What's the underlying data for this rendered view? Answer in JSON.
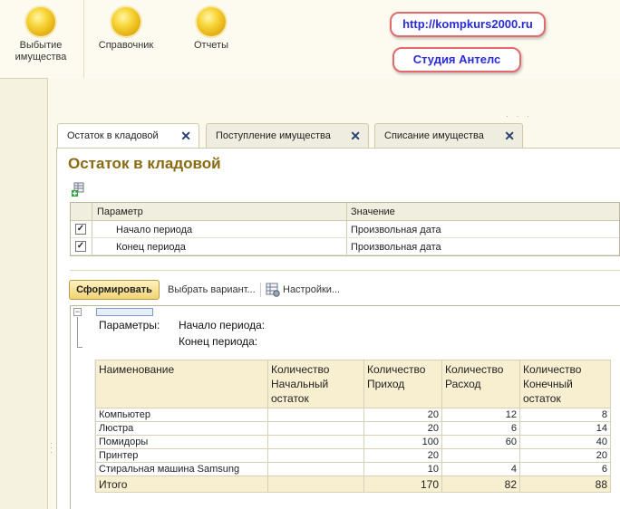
{
  "top_sections": [
    {
      "label": "Выбытие имущества",
      "icon": "orb-icon"
    },
    {
      "label": "Справочник",
      "icon": "orb-icon"
    },
    {
      "label": "Отчеты",
      "icon": "orb-icon"
    }
  ],
  "badges": {
    "site": "http://kompkurs2000.ru",
    "studio": "Студия Антелс"
  },
  "tabs": [
    {
      "label": "Остаток в кладовой",
      "active": true
    },
    {
      "label": "Поступление имущества",
      "active": false
    },
    {
      "label": "Списание имущества",
      "active": false
    }
  ],
  "page_title": "Остаток в кладовой",
  "settings": {
    "headers": {
      "param": "Параметр",
      "value": "Значение"
    },
    "rows": [
      {
        "checked": true,
        "param": "Начало периода",
        "value": "Произвольная дата"
      },
      {
        "checked": true,
        "param": "Конец периода",
        "value": "Произвольная дата"
      }
    ]
  },
  "toolbar": {
    "generate": "Сформировать",
    "choose_variant": "Выбрать вариант...",
    "settings": "Настройки..."
  },
  "report": {
    "params_label": "Параметры:",
    "start_label": "Начало периода:",
    "end_label": "Конец периода:",
    "headers": {
      "name": "Наименование",
      "begin": [
        "Количество",
        "Начальный",
        "остаток"
      ],
      "income": [
        "Количество",
        "Приход"
      ],
      "expense": [
        "Количество",
        "Расход"
      ],
      "end": [
        "Количество",
        "Конечный",
        "остаток"
      ]
    },
    "rows": [
      {
        "name": "Компьютер",
        "begin": "",
        "income": "20",
        "expense": "12",
        "end": "8"
      },
      {
        "name": "Люстра",
        "begin": "",
        "income": "20",
        "expense": "6",
        "end": "14"
      },
      {
        "name": "Помидоры",
        "begin": "",
        "income": "100",
        "expense": "60",
        "end": "40"
      },
      {
        "name": "Принтер",
        "begin": "",
        "income": "20",
        "expense": "",
        "end": "20"
      },
      {
        "name": "Стиральная машина Samsung",
        "begin": "",
        "income": "10",
        "expense": "4",
        "end": "6"
      }
    ],
    "total": {
      "name": "Итого",
      "begin": "",
      "income": "170",
      "expense": "82",
      "end": "88"
    }
  },
  "colors": {
    "accent_title": "#8a6a10",
    "tab_close": "#28406d",
    "badge_border": "#e26a6a",
    "badge_text": "#2b2bd6"
  }
}
